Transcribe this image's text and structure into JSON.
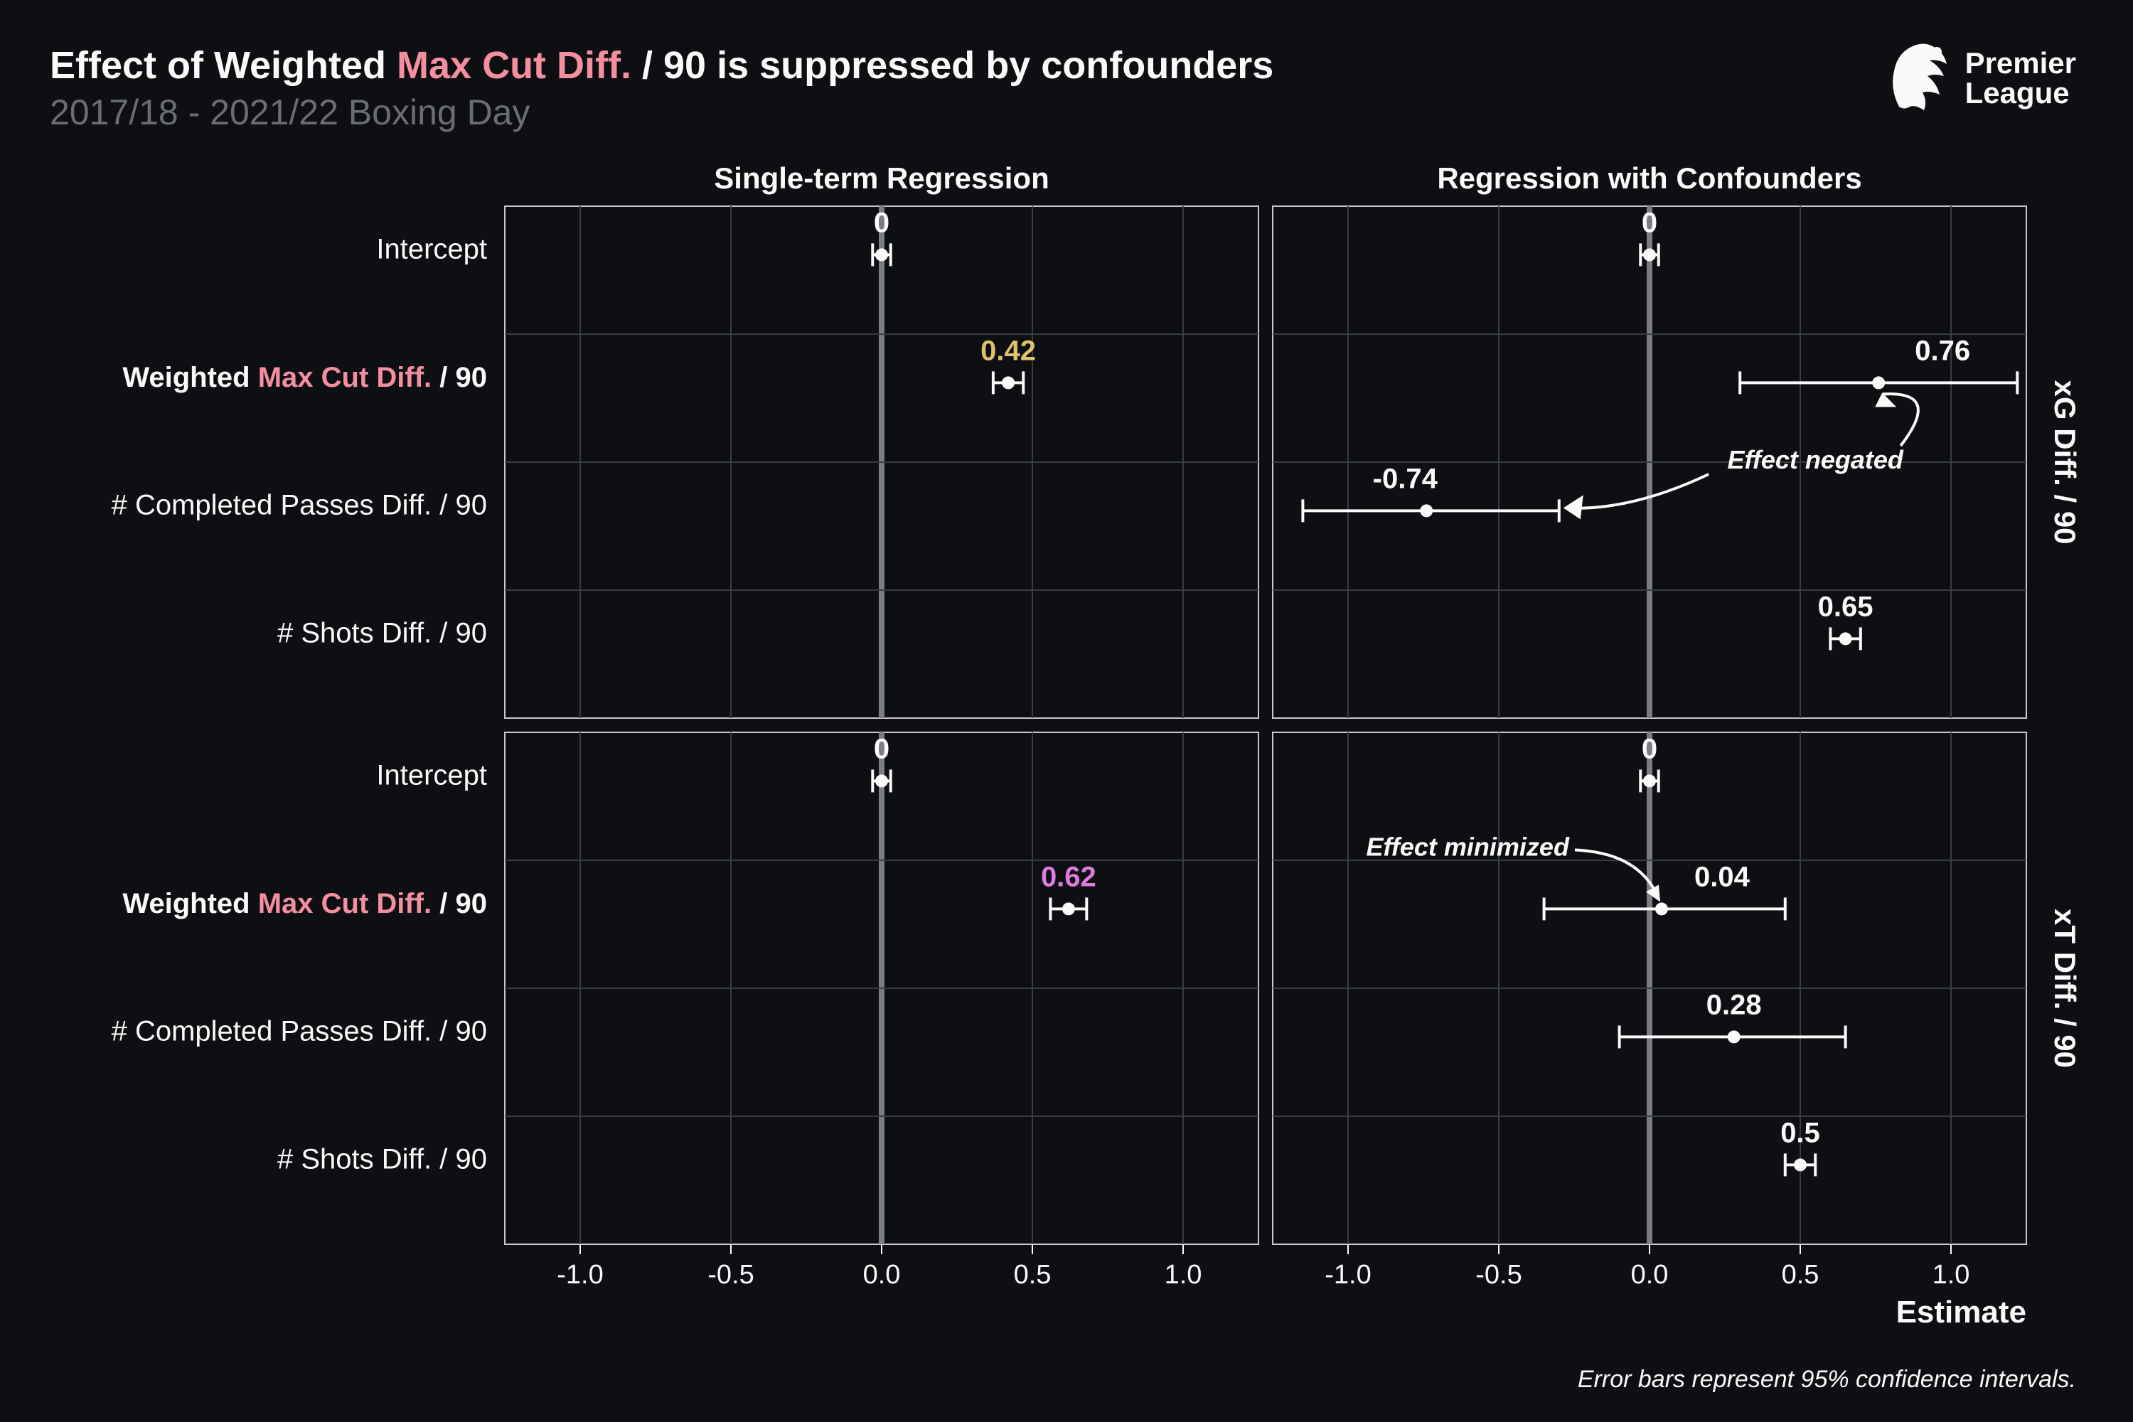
{
  "title_prefix": "Effect of Weighted ",
  "title_hl": "Max Cut Diff.",
  "title_suffix": " / 90 is suppressed by confounders",
  "subtitle": "2017/18 - 2021/22 Boxing Day",
  "logo_line1": "Premier",
  "logo_line2": "League",
  "facet_cols": [
    "Single-term Regression",
    "Regression with Confounders"
  ],
  "facet_rows": [
    "xG Diff. / 90",
    "xT Diff. / 90"
  ],
  "y_categories": [
    {
      "label": "Intercept",
      "hl": false
    },
    {
      "label_pre": "Weighted ",
      "label_hl": "Max Cut Diff.",
      "label_post": " / 90",
      "hl": true
    },
    {
      "label": "# Completed Passes Diff. / 90",
      "hl": false
    },
    {
      "label": "# Shots Diff. / 90",
      "hl": false
    }
  ],
  "x_axis": {
    "min": -1.25,
    "max": 1.25,
    "ticks": [
      -1.0,
      -0.5,
      0.0,
      0.5,
      1.0
    ],
    "title": "Estimate"
  },
  "annotations": {
    "effect_negated": "Effect negated",
    "effect_minimized": "Effect minimized"
  },
  "footnote": "Error bars represent 95% confidence intervals.",
  "chart_data": {
    "type": "forest-plot",
    "xlabel": "Estimate",
    "xlim": [
      -1.25,
      1.25
    ],
    "panels": [
      {
        "col": "Single-term Regression",
        "row": "xG Diff. / 90",
        "points": [
          {
            "cat": "Intercept",
            "estimate": 0.0,
            "lo": -0.03,
            "hi": 0.03,
            "label": "0"
          },
          {
            "cat": "Weighted Max Cut Diff. / 90",
            "estimate": 0.42,
            "lo": 0.37,
            "hi": 0.47,
            "label": "0.42",
            "color": "gold"
          }
        ]
      },
      {
        "col": "Regression with Confounders",
        "row": "xG Diff. / 90",
        "points": [
          {
            "cat": "Intercept",
            "estimate": 0.0,
            "lo": -0.03,
            "hi": 0.03,
            "label": "0"
          },
          {
            "cat": "Weighted Max Cut Diff. / 90",
            "estimate": 0.76,
            "lo": 0.3,
            "hi": 1.22,
            "label": "0.76"
          },
          {
            "cat": "# Completed Passes Diff. / 90",
            "estimate": -0.74,
            "lo": -1.15,
            "hi": -0.3,
            "label": "-0.74"
          },
          {
            "cat": "# Shots Diff. / 90",
            "estimate": 0.65,
            "lo": 0.6,
            "hi": 0.7,
            "label": "0.65"
          }
        ],
        "annotation": "Effect negated"
      },
      {
        "col": "Single-term Regression",
        "row": "xT Diff. / 90",
        "points": [
          {
            "cat": "Intercept",
            "estimate": 0.0,
            "lo": -0.03,
            "hi": 0.03,
            "label": "0"
          },
          {
            "cat": "Weighted Max Cut Diff. / 90",
            "estimate": 0.62,
            "lo": 0.56,
            "hi": 0.68,
            "label": "0.62",
            "color": "pink"
          }
        ]
      },
      {
        "col": "Regression with Confounders",
        "row": "xT Diff. / 90",
        "points": [
          {
            "cat": "Intercept",
            "estimate": 0.0,
            "lo": -0.03,
            "hi": 0.03,
            "label": "0"
          },
          {
            "cat": "Weighted Max Cut Diff. / 90",
            "estimate": 0.04,
            "lo": -0.35,
            "hi": 0.45,
            "label": "0.04"
          },
          {
            "cat": "# Completed Passes Diff. / 90",
            "estimate": 0.28,
            "lo": -0.1,
            "hi": 0.65,
            "label": "0.28"
          },
          {
            "cat": "# Shots Diff. / 90",
            "estimate": 0.5,
            "lo": 0.45,
            "hi": 0.55,
            "label": "0.5"
          }
        ],
        "annotation": "Effect minimized"
      }
    ]
  }
}
